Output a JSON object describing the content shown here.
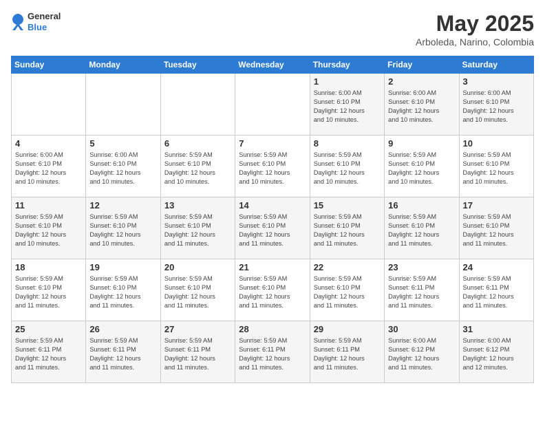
{
  "header": {
    "logo_line1": "General",
    "logo_line2": "Blue",
    "month": "May 2025",
    "location": "Arboleda, Narino, Colombia"
  },
  "weekdays": [
    "Sunday",
    "Monday",
    "Tuesday",
    "Wednesday",
    "Thursday",
    "Friday",
    "Saturday"
  ],
  "weeks": [
    [
      {
        "day": "",
        "info": ""
      },
      {
        "day": "",
        "info": ""
      },
      {
        "day": "",
        "info": ""
      },
      {
        "day": "",
        "info": ""
      },
      {
        "day": "1",
        "info": "Sunrise: 6:00 AM\nSunset: 6:10 PM\nDaylight: 12 hours\nand 10 minutes."
      },
      {
        "day": "2",
        "info": "Sunrise: 6:00 AM\nSunset: 6:10 PM\nDaylight: 12 hours\nand 10 minutes."
      },
      {
        "day": "3",
        "info": "Sunrise: 6:00 AM\nSunset: 6:10 PM\nDaylight: 12 hours\nand 10 minutes."
      }
    ],
    [
      {
        "day": "4",
        "info": "Sunrise: 6:00 AM\nSunset: 6:10 PM\nDaylight: 12 hours\nand 10 minutes."
      },
      {
        "day": "5",
        "info": "Sunrise: 6:00 AM\nSunset: 6:10 PM\nDaylight: 12 hours\nand 10 minutes."
      },
      {
        "day": "6",
        "info": "Sunrise: 5:59 AM\nSunset: 6:10 PM\nDaylight: 12 hours\nand 10 minutes."
      },
      {
        "day": "7",
        "info": "Sunrise: 5:59 AM\nSunset: 6:10 PM\nDaylight: 12 hours\nand 10 minutes."
      },
      {
        "day": "8",
        "info": "Sunrise: 5:59 AM\nSunset: 6:10 PM\nDaylight: 12 hours\nand 10 minutes."
      },
      {
        "day": "9",
        "info": "Sunrise: 5:59 AM\nSunset: 6:10 PM\nDaylight: 12 hours\nand 10 minutes."
      },
      {
        "day": "10",
        "info": "Sunrise: 5:59 AM\nSunset: 6:10 PM\nDaylight: 12 hours\nand 10 minutes."
      }
    ],
    [
      {
        "day": "11",
        "info": "Sunrise: 5:59 AM\nSunset: 6:10 PM\nDaylight: 12 hours\nand 10 minutes."
      },
      {
        "day": "12",
        "info": "Sunrise: 5:59 AM\nSunset: 6:10 PM\nDaylight: 12 hours\nand 10 minutes."
      },
      {
        "day": "13",
        "info": "Sunrise: 5:59 AM\nSunset: 6:10 PM\nDaylight: 12 hours\nand 11 minutes."
      },
      {
        "day": "14",
        "info": "Sunrise: 5:59 AM\nSunset: 6:10 PM\nDaylight: 12 hours\nand 11 minutes."
      },
      {
        "day": "15",
        "info": "Sunrise: 5:59 AM\nSunset: 6:10 PM\nDaylight: 12 hours\nand 11 minutes."
      },
      {
        "day": "16",
        "info": "Sunrise: 5:59 AM\nSunset: 6:10 PM\nDaylight: 12 hours\nand 11 minutes."
      },
      {
        "day": "17",
        "info": "Sunrise: 5:59 AM\nSunset: 6:10 PM\nDaylight: 12 hours\nand 11 minutes."
      }
    ],
    [
      {
        "day": "18",
        "info": "Sunrise: 5:59 AM\nSunset: 6:10 PM\nDaylight: 12 hours\nand 11 minutes."
      },
      {
        "day": "19",
        "info": "Sunrise: 5:59 AM\nSunset: 6:10 PM\nDaylight: 12 hours\nand 11 minutes."
      },
      {
        "day": "20",
        "info": "Sunrise: 5:59 AM\nSunset: 6:10 PM\nDaylight: 12 hours\nand 11 minutes."
      },
      {
        "day": "21",
        "info": "Sunrise: 5:59 AM\nSunset: 6:10 PM\nDaylight: 12 hours\nand 11 minutes."
      },
      {
        "day": "22",
        "info": "Sunrise: 5:59 AM\nSunset: 6:10 PM\nDaylight: 12 hours\nand 11 minutes."
      },
      {
        "day": "23",
        "info": "Sunrise: 5:59 AM\nSunset: 6:11 PM\nDaylight: 12 hours\nand 11 minutes."
      },
      {
        "day": "24",
        "info": "Sunrise: 5:59 AM\nSunset: 6:11 PM\nDaylight: 12 hours\nand 11 minutes."
      }
    ],
    [
      {
        "day": "25",
        "info": "Sunrise: 5:59 AM\nSunset: 6:11 PM\nDaylight: 12 hours\nand 11 minutes."
      },
      {
        "day": "26",
        "info": "Sunrise: 5:59 AM\nSunset: 6:11 PM\nDaylight: 12 hours\nand 11 minutes."
      },
      {
        "day": "27",
        "info": "Sunrise: 5:59 AM\nSunset: 6:11 PM\nDaylight: 12 hours\nand 11 minutes."
      },
      {
        "day": "28",
        "info": "Sunrise: 5:59 AM\nSunset: 6:11 PM\nDaylight: 12 hours\nand 11 minutes."
      },
      {
        "day": "29",
        "info": "Sunrise: 5:59 AM\nSunset: 6:11 PM\nDaylight: 12 hours\nand 11 minutes."
      },
      {
        "day": "30",
        "info": "Sunrise: 6:00 AM\nSunset: 6:12 PM\nDaylight: 12 hours\nand 11 minutes."
      },
      {
        "day": "31",
        "info": "Sunrise: 6:00 AM\nSunset: 6:12 PM\nDaylight: 12 hours\nand 12 minutes."
      }
    ]
  ]
}
